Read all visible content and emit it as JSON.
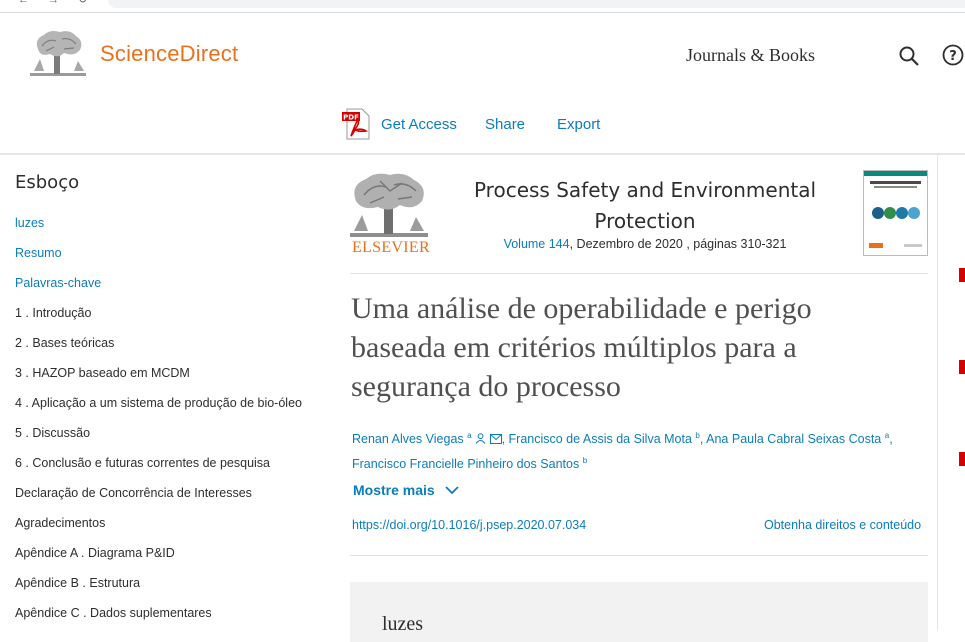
{
  "brand": {
    "name": "ScienceDirect",
    "accent": "#e9711c"
  },
  "header": {
    "journals_books": "Journals & Books"
  },
  "actions": {
    "get_access": "Get Access",
    "share": "Share",
    "export": "Export"
  },
  "sidebar": {
    "title": "Esboço",
    "items": [
      "luzes",
      "Resumo",
      "Palavras-chave",
      "1 . Introdução",
      "2 . Bases teóricas",
      "3 . HAZOP baseado em MCDM",
      "4 . Aplicação a um sistema de produção de bio-óleo",
      "5 . Discussão",
      "6 . Conclusão e futuras correntes de pesquisa",
      "Declaração de Concorrência de Interesses",
      "Agradecimentos",
      "Apêndice A . Diagrama P&ID",
      "Apêndice B . Estrutura",
      "Apêndice C . Dados suplementares"
    ]
  },
  "journal": {
    "publisher": "ELSEVIER",
    "title_line1": "Process Safety and Environmental",
    "title_line2": "Protection",
    "volume": "Volume 144",
    "date_pages": ", Dezembro de 2020 , páginas 310-321"
  },
  "article": {
    "title": "Uma análise de operabilidade e perigo baseada em critérios múltiplos para a segurança do processo",
    "authors": [
      {
        "name": "Renan Alves Viegas",
        "sup": "a"
      },
      {
        "name": "Francisco de Assis da Silva Mota",
        "sup": "b"
      },
      {
        "name": "Ana Paula Cabral Seixas Costa",
        "sup": "a"
      },
      {
        "name": "Francisco Francielle Pinheiro dos Santos",
        "sup": "b"
      }
    ],
    "show_more": "Mostre mais",
    "doi": "https://doi.org/10.1016/j.psep.2020.07.034",
    "rights": "Obtenha direitos e conteúdo",
    "highlights_heading": "luzes"
  },
  "colors": {
    "link": "#0c7dbb",
    "text": "#2e2e2e",
    "title": "#505050"
  }
}
